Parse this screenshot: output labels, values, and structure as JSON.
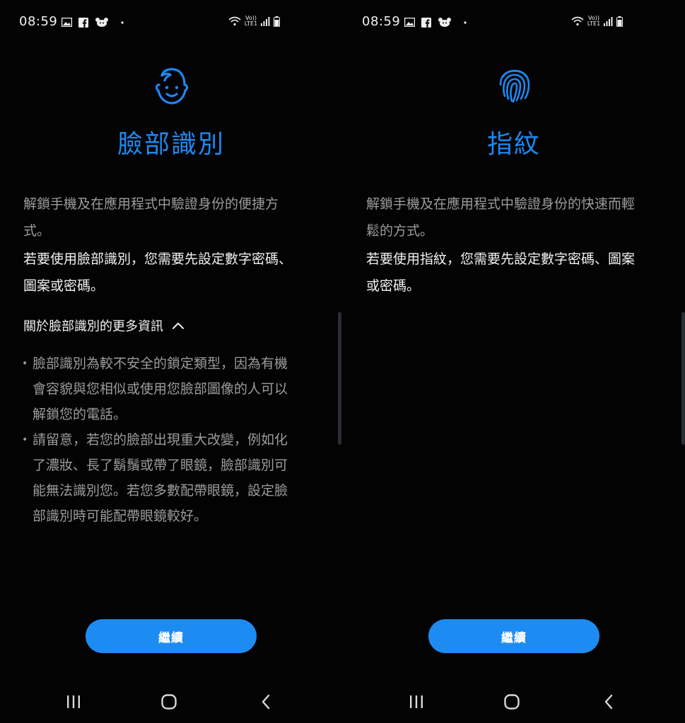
{
  "colors": {
    "accent": "#1e88f0",
    "button": "#1d8cf2",
    "background": "#030304",
    "primary_text": "#f2f2f2",
    "secondary_text": "#9c9c9c"
  },
  "screens": [
    {
      "status_bar": {
        "time": "08:59",
        "notification_icons": [
          "gallery-icon",
          "facebook-icon",
          "app-mascot-icon",
          "dot-icon"
        ],
        "network_label": "LTE1",
        "volte_label": "Vo))"
      },
      "header_icon": "face-icon",
      "title": "臉部識別",
      "description": "解鎖手機及在應用程式中驗證身份的便捷方式。",
      "requirement": "若要使用臉部識別，您需要先設定數字密碼、圖案或密碼。",
      "more_info": {
        "label": "關於臉部識別的更多資訊",
        "expanded_icon": "chevron-up-icon",
        "bullets": [
          "臉部識別為較不安全的鎖定類型，因為有機會容貌與您相似或使用您臉部圖像的人可以解鎖您的電話。",
          "請留意，若您的臉部出現重大改變，例如化了濃妝、長了鬍鬚或帶了眼鏡，臉部識別可能無法識別您。若您多數配帶眼鏡，設定臉部識別時可能配帶眼鏡較好。"
        ]
      },
      "continue_label": "繼續"
    },
    {
      "status_bar": {
        "time": "08:59",
        "notification_icons": [
          "gallery-icon",
          "facebook-icon",
          "app-mascot-icon",
          "dot-icon"
        ],
        "network_label": "LTE1",
        "volte_label": "Vo))"
      },
      "header_icon": "fingerprint-icon",
      "title": "指紋",
      "description": "解鎖手機及在應用程式中驗證身份的快速而輕鬆的方式。",
      "requirement": "若要使用指紋，您需要先設定數字密碼、圖案或密碼。",
      "continue_label": "繼續"
    }
  ],
  "nav_bar": {
    "icons": [
      "recents-icon",
      "home-icon",
      "back-icon"
    ]
  }
}
